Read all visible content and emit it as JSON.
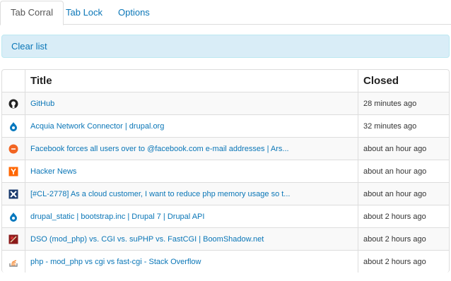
{
  "tabs": [
    {
      "label": "Tab Corral",
      "active": true
    },
    {
      "label": "Tab Lock",
      "active": false
    },
    {
      "label": "Options",
      "active": false
    }
  ],
  "alert": {
    "clear_label": "Clear list"
  },
  "table": {
    "headers": {
      "title": "Title",
      "closed": "Closed"
    },
    "rows": [
      {
        "icon": "github-icon",
        "title": "GitHub",
        "closed": "28 minutes ago"
      },
      {
        "icon": "drupal-icon",
        "title": "Acquia Network Connector | drupal.org",
        "closed": "32 minutes ago"
      },
      {
        "icon": "orange-circle-icon",
        "title": "Facebook forces all users over to @facebook.com e-mail addresses | Ars...",
        "closed": "about an hour ago"
      },
      {
        "icon": "hackernews-icon",
        "title": "Hacker News",
        "closed": "about an hour ago"
      },
      {
        "icon": "mascot-icon",
        "title": "[#CL-2778] As a cloud customer, I want to reduce php memory usage so t...",
        "closed": "about an hour ago"
      },
      {
        "icon": "drupal-icon",
        "title": "drupal_static | bootstrap.inc | Drupal 7 | Drupal API",
        "closed": "about 2 hours ago"
      },
      {
        "icon": "red-square-icon",
        "title": "DSO (mod_php) vs. CGI vs. suPHP vs. FastCGI | BoomShadow.net",
        "closed": "about 2 hours ago"
      },
      {
        "icon": "stackoverflow-icon",
        "title": "php - mod_php vs cgi vs fast-cgi - Stack Overflow",
        "closed": "about 2 hours ago"
      }
    ]
  },
  "colors": {
    "link": "#0a76b7",
    "alert_bg": "#d9edf7"
  }
}
